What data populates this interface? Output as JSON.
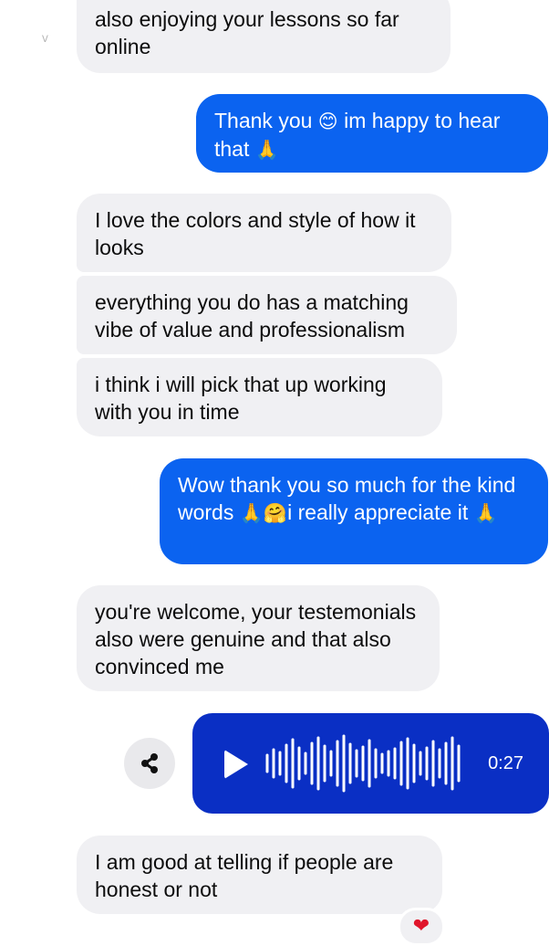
{
  "colors": {
    "incoming_bg": "#f0f0f3",
    "outgoing_bg": "#0b63f0",
    "voice_bg": "#0a2fc4",
    "reaction": "#e0162b"
  },
  "messages": [
    {
      "from": "them",
      "text": "also enjoying your lessons so far online"
    },
    {
      "from": "me",
      "text_a": "Thank you ",
      "emoji_a": "😊",
      "text_b": " im happy to hear that ",
      "emoji_b": "🙏"
    },
    {
      "from": "them",
      "text": "I love the colors and style of how it looks"
    },
    {
      "from": "them",
      "text": "everything you do has a matching vibe of value and professionalism"
    },
    {
      "from": "them",
      "text": "i think i will pick that up working with you in time"
    },
    {
      "from": "me",
      "text_a": "Wow thank you so much for the kind words ",
      "emoji_a": "🙏",
      "emoji_b": "🤗",
      "text_b": "i really appreciate it ",
      "emoji_c": "🙏"
    },
    {
      "from": "them",
      "text": "you're welcome, your testemonials also were genuine and that also convinced me"
    },
    {
      "from": "me",
      "type": "voice",
      "duration": "0:27",
      "icon_play": "play-icon",
      "icon_share": "share-icon"
    },
    {
      "from": "them",
      "text": "I am good at telling if people are honest or not",
      "reaction": "❤"
    }
  ]
}
